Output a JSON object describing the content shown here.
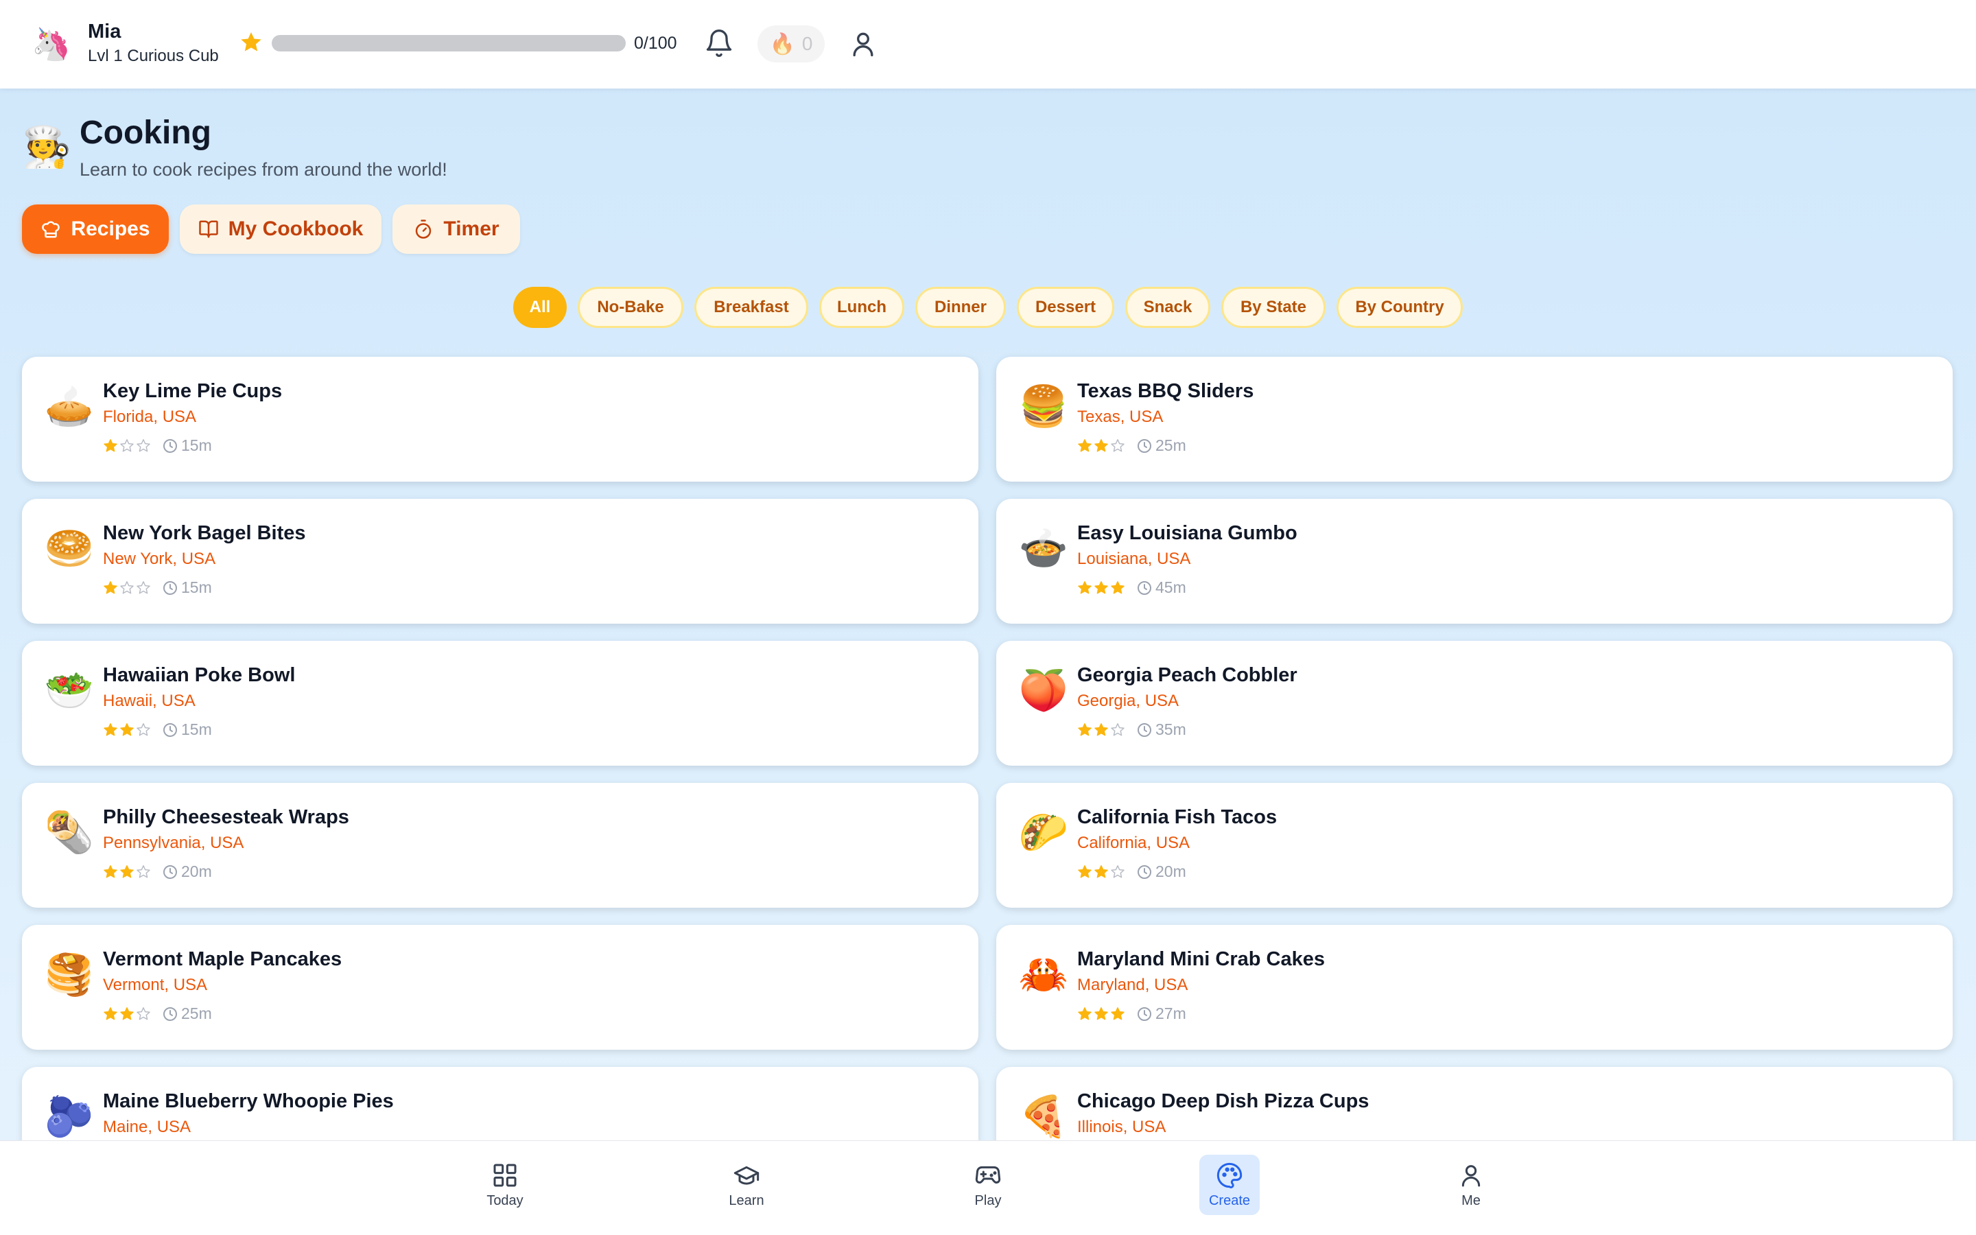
{
  "user": {
    "avatar": "🦄",
    "name": "Mia",
    "level": "Lvl 1 Curious Cub",
    "xp_text": "0/100",
    "xp_progress": 0,
    "streak_icon": "🔥",
    "streak_count": "0"
  },
  "page": {
    "icon": "🧑‍🍳",
    "title": "Cooking",
    "subtitle": "Learn to cook recipes from around the world!"
  },
  "tabs": [
    {
      "label": "Recipes",
      "icon": "chef-hat-icon",
      "active": true
    },
    {
      "label": "My Cookbook",
      "icon": "book-icon",
      "active": false
    },
    {
      "label": "Timer",
      "icon": "timer-icon",
      "active": false
    }
  ],
  "filters": [
    {
      "label": "All",
      "active": true
    },
    {
      "label": "No-Bake",
      "active": false
    },
    {
      "label": "Breakfast",
      "active": false
    },
    {
      "label": "Lunch",
      "active": false
    },
    {
      "label": "Dinner",
      "active": false
    },
    {
      "label": "Dessert",
      "active": false
    },
    {
      "label": "Snack",
      "active": false
    },
    {
      "label": "By State",
      "active": false
    },
    {
      "label": "By Country",
      "active": false
    }
  ],
  "recipes": [
    {
      "emoji": "🥧",
      "title": "Key Lime Pie Cups",
      "location": "Florida, USA",
      "difficulty": 1,
      "time": "15m"
    },
    {
      "emoji": "🍔",
      "title": "Texas BBQ Sliders",
      "location": "Texas, USA",
      "difficulty": 2,
      "time": "25m"
    },
    {
      "emoji": "🥯",
      "title": "New York Bagel Bites",
      "location": "New York, USA",
      "difficulty": 1,
      "time": "15m"
    },
    {
      "emoji": "🍲",
      "title": "Easy Louisiana Gumbo",
      "location": "Louisiana, USA",
      "difficulty": 3,
      "time": "45m"
    },
    {
      "emoji": "🥗",
      "title": "Hawaiian Poke Bowl",
      "location": "Hawaii, USA",
      "difficulty": 2,
      "time": "15m"
    },
    {
      "emoji": "🍑",
      "title": "Georgia Peach Cobbler",
      "location": "Georgia, USA",
      "difficulty": 2,
      "time": "35m"
    },
    {
      "emoji": "🌯",
      "title": "Philly Cheesesteak Wraps",
      "location": "Pennsylvania, USA",
      "difficulty": 2,
      "time": "20m"
    },
    {
      "emoji": "🌮",
      "title": "California Fish Tacos",
      "location": "California, USA",
      "difficulty": 2,
      "time": "20m"
    },
    {
      "emoji": "🥞",
      "title": "Vermont Maple Pancakes",
      "location": "Vermont, USA",
      "difficulty": 2,
      "time": "25m"
    },
    {
      "emoji": "🦀",
      "title": "Maryland Mini Crab Cakes",
      "location": "Maryland, USA",
      "difficulty": 3,
      "time": "27m"
    },
    {
      "emoji": "🫐",
      "title": "Maine Blueberry Whoopie Pies",
      "location": "Maine, USA",
      "difficulty": 0,
      "time": ""
    },
    {
      "emoji": "🍕",
      "title": "Chicago Deep Dish Pizza Cups",
      "location": "Illinois, USA",
      "difficulty": 0,
      "time": ""
    }
  ],
  "nav": [
    {
      "label": "Today",
      "icon": "grid-icon",
      "active": false
    },
    {
      "label": "Learn",
      "icon": "graduation-cap-icon",
      "active": false
    },
    {
      "label": "Play",
      "icon": "gamepad-icon",
      "active": false
    },
    {
      "label": "Create",
      "icon": "palette-icon",
      "active": true
    },
    {
      "label": "Me",
      "icon": "user-icon",
      "active": false
    }
  ],
  "colors": {
    "accent": "#fb6a12",
    "chip_active": "#fbb50d",
    "location": "#ea580c",
    "star": "#fbb50d",
    "nav_active": "#2563eb"
  }
}
